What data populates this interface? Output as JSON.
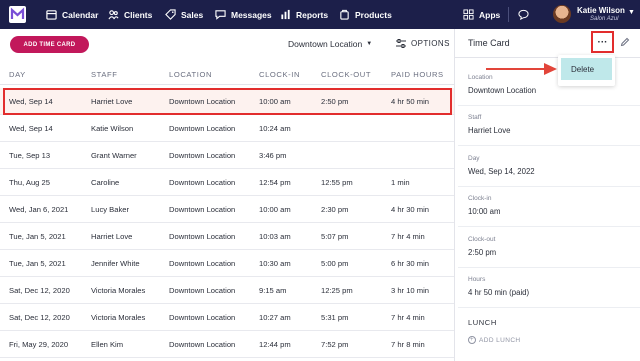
{
  "nav": {
    "items": [
      {
        "label": "Calendar",
        "icon": "calendar-icon"
      },
      {
        "label": "Clients",
        "icon": "clients-icon"
      },
      {
        "label": "Sales",
        "icon": "sales-tag-icon"
      },
      {
        "label": "Messages",
        "icon": "messages-icon"
      },
      {
        "label": "Reports",
        "icon": "reports-icon"
      },
      {
        "label": "Products",
        "icon": "products-icon"
      }
    ],
    "apps_label": "Apps",
    "user_name": "Katie Wilson",
    "user_sub": "Salon Azul"
  },
  "toolbar": {
    "add_label": "ADD TIME CARD",
    "location_label": "Downtown Location",
    "options_label": "OPTIONS"
  },
  "table": {
    "headers": [
      "DAY",
      "STAFF",
      "LOCATION",
      "CLOCK-IN",
      "CLOCK-OUT",
      "PAID HOURS"
    ],
    "rows": [
      [
        "Wed, Sep 14",
        "Harriet Love",
        "Downtown Location",
        "10:00 am",
        "2:50 pm",
        "4 hr 50 min"
      ],
      [
        "Wed, Sep 14",
        "Katie Wilson",
        "Downtown Location",
        "10:24 am",
        "",
        ""
      ],
      [
        "Tue, Sep 13",
        "Grant Warner",
        "Downtown Location",
        "3:46 pm",
        "",
        ""
      ],
      [
        "Thu, Aug 25",
        "Caroline",
        "Downtown Location",
        "12:54 pm",
        "12:55 pm",
        "1 min"
      ],
      [
        "Wed, Jan 6, 2021",
        "Lucy Baker",
        "Downtown Location",
        "10:00 am",
        "2:30 pm",
        "4 hr 30 min"
      ],
      [
        "Tue, Jan 5, 2021",
        "Harriet Love",
        "Downtown Location",
        "10:03 am",
        "5:07 pm",
        "7 hr 4 min"
      ],
      [
        "Tue, Jan 5, 2021",
        "Jennifer White",
        "Downtown Location",
        "10:30 am",
        "5:00 pm",
        "6 hr 30 min"
      ],
      [
        "Sat, Dec 12, 2020",
        "Victoria Morales",
        "Downtown Location",
        "9:15 am",
        "12:25 pm",
        "3 hr 10 min"
      ],
      [
        "Sat, Dec 12, 2020",
        "Victoria Morales",
        "Downtown Location",
        "10:27 am",
        "5:31 pm",
        "7 hr 4 min"
      ],
      [
        "Fri, May 29, 2020",
        "Ellen Kim",
        "Downtown Location",
        "12:44 pm",
        "7:52 pm",
        "7 hr 8 min"
      ]
    ]
  },
  "panel": {
    "title": "Time Card",
    "menu_item": "Delete",
    "fields": [
      {
        "label": "Location",
        "value": "Downtown Location"
      },
      {
        "label": "Staff",
        "value": "Harriet Love"
      },
      {
        "label": "Day",
        "value": "Wed, Sep 14, 2022"
      },
      {
        "label": "Clock-in",
        "value": "10:00 am"
      },
      {
        "label": "Clock-out",
        "value": "2:50 pm"
      },
      {
        "label": "Hours",
        "value": "4 hr 50 min (paid)"
      }
    ],
    "lunch_title": "LUNCH",
    "add_lunch_label": "ADD LUNCH"
  },
  "colors": {
    "nav_bg": "#1c1f4a",
    "accent": "#c2185b",
    "highlight": "#e22d2d",
    "menu_hover": "#bfe8ea"
  }
}
